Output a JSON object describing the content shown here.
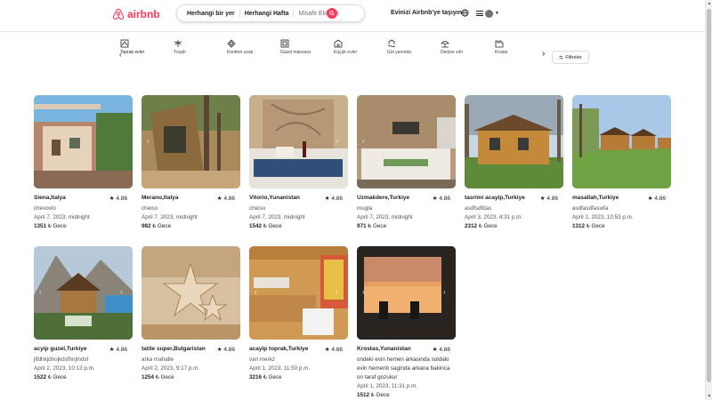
{
  "header": {
    "logo_text": "airbnb",
    "search": {
      "location": "Herhangi bir yer",
      "week": "Herhangi Hafta",
      "guests": "Misafir Ekleyin"
    },
    "host_link": "Evinizi Airbnb'ye taşıyın"
  },
  "categories": [
    {
      "label": "Toprak evler",
      "icon": "earth-house-icon"
    },
    {
      "label": "Tropik",
      "icon": "palm-tree-icon"
    },
    {
      "label": "Kentten uzak",
      "icon": "diamond-icon"
    },
    {
      "label": "Güzel manzara",
      "icon": "picture-frame-icon"
    },
    {
      "label": "Küçük evler",
      "icon": "small-house-icon"
    },
    {
      "label": "Göl yanında",
      "icon": "lake-icon"
    },
    {
      "label": "Denize sıfır",
      "icon": "beach-icon"
    },
    {
      "label": "Kiralar",
      "icon": "castle-icon"
    }
  ],
  "filters_label": "Filtreler",
  "listings": [
    {
      "title": "Siena,Italya",
      "rating": "4.86",
      "host": "chevovio",
      "date": "April 7, 2023, midnight",
      "price": "1351",
      "unit": "₺ Gece",
      "desc": ""
    },
    {
      "title": "Merano,Italya",
      "rating": "4.86",
      "host": "cheiso",
      "date": "April 7, 2023, midnight",
      "price": "982",
      "unit": "₺ Gece",
      "desc": ""
    },
    {
      "title": "Vitorio,Yunanistan",
      "rating": "4.86",
      "host": "cheiso",
      "date": "April 7, 2023, midnight",
      "price": "1542",
      "unit": "₺ Gece",
      "desc": ""
    },
    {
      "title": "Uzmakdere,Turkiye",
      "rating": "4.86",
      "host": "mugla",
      "date": "April 7, 2023, midnight",
      "price": "971",
      "unit": "₺ Gece",
      "desc": ""
    },
    {
      "title": "tasrimi acayip,Turkiye",
      "rating": "4.86",
      "host": "asdfsdfdas",
      "date": "April 3, 2023, 4:31 p.m.",
      "price": "2312",
      "unit": "₺ Gece",
      "desc": ""
    },
    {
      "title": "masallah,Turkiye",
      "rating": "4.86",
      "host": "asdfasdfaswfa",
      "date": "April 2, 2023, 10:53 p.m.",
      "price": "1312",
      "unit": "₺ Gece",
      "desc": ""
    },
    {
      "title": "acyip guzel,Turkiye",
      "rating": "4.86",
      "host": "jlfdhkjdhojkdsfhnjlndsf",
      "date": "April 2, 2023, 10:13 p.m.",
      "price": "1522",
      "unit": "₺ Gece",
      "desc": ""
    },
    {
      "title": "tatile super,Bulgaristan",
      "rating": "4.86",
      "host": "arka mahalle",
      "date": "April 2, 2023, 9:17 p.m.",
      "price": "1254",
      "unit": "₺ Gece",
      "desc": ""
    },
    {
      "title": "acayip toprak,Turkiye",
      "rating": "4.86",
      "host": "van merkz",
      "date": "April 1, 2023, 11:50 p.m.",
      "price": "3216",
      "unit": "₺ Gece",
      "desc": ""
    },
    {
      "title": "Krostas,Yunanistan",
      "rating": "4.86",
      "host": "",
      "date": "April 1, 2023, 11:31 p.m.",
      "price": "1512",
      "unit": "₺ Gece",
      "desc": "ondeki evin hemen arkasinda soldaki evin hemenb saginda arkana bakinca on taraf gozukur"
    }
  ],
  "colors": {
    "brand": "#ff385c"
  }
}
